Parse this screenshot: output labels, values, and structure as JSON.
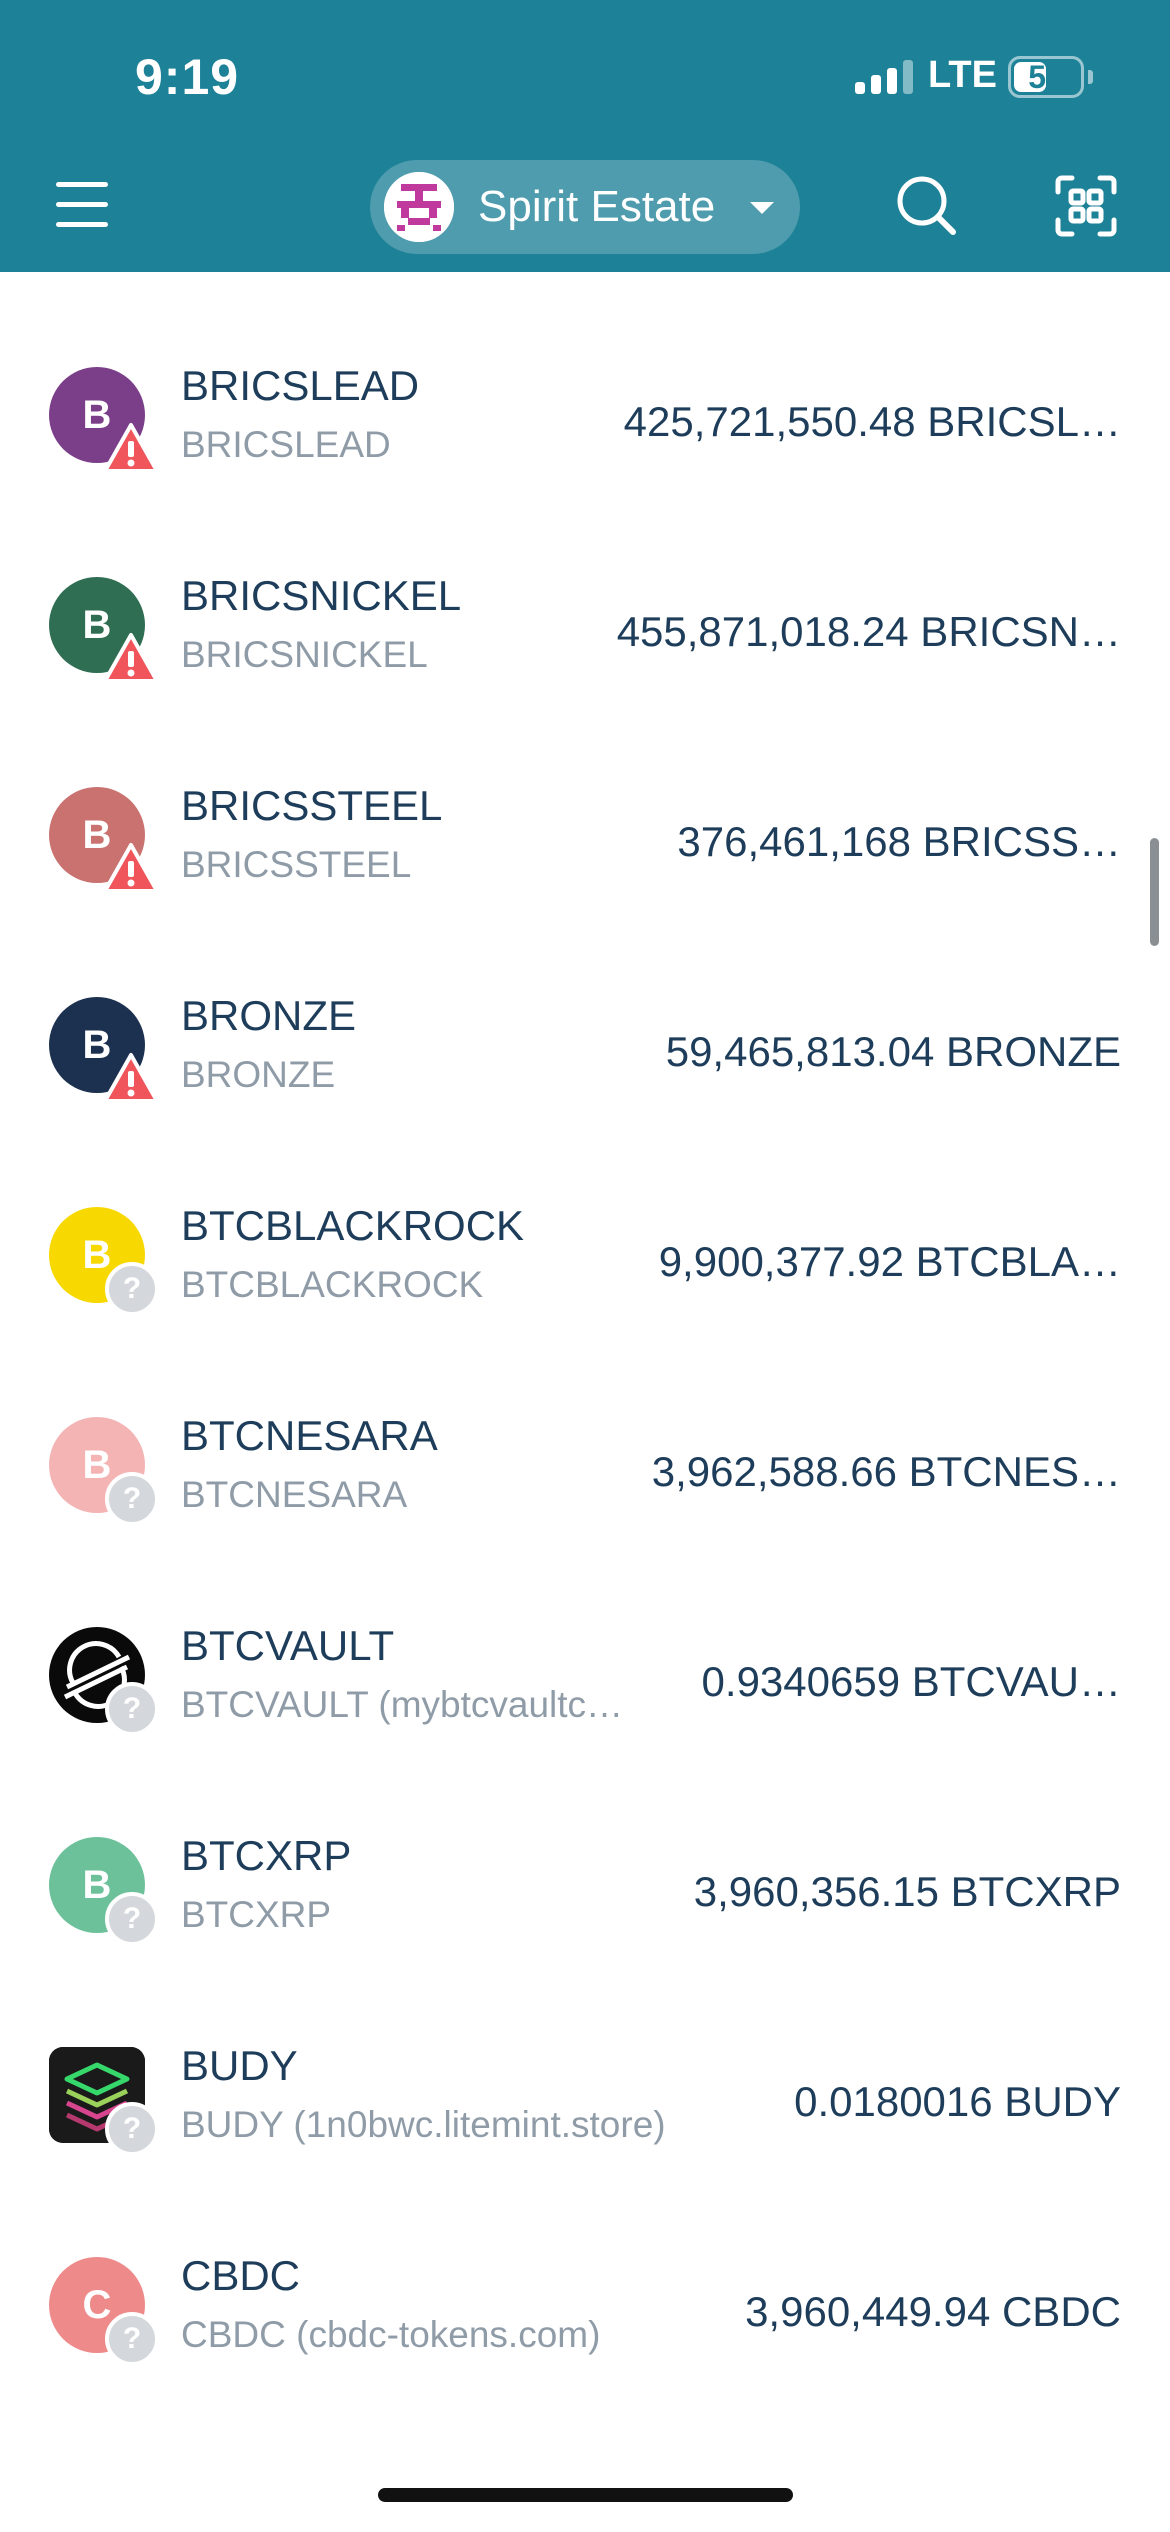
{
  "status_bar": {
    "time": "9:19",
    "network": "LTE",
    "battery": "54",
    "battery_level_percent": 54
  },
  "header": {
    "account_name": "Spirit Estate",
    "icons": {
      "menu": "menu-icon",
      "search": "search-icon",
      "scan": "qr-scan-icon"
    },
    "colors": {
      "background": "#1d8197"
    }
  },
  "assets": [
    {
      "initial": "B",
      "name": "BRICSLEAD",
      "code": "BRICSLEAD",
      "amount": "425,721,550.48 BRICSL…",
      "avatar_color": "#7b3f8a",
      "badge": "warning"
    },
    {
      "initial": "B",
      "name": "BRICSNICKEL",
      "code": "BRICSNICKEL",
      "amount": "455,871,018.24 BRICSN…",
      "avatar_color": "#2f6e52",
      "badge": "warning"
    },
    {
      "initial": "B",
      "name": "BRICSSTEEL",
      "code": "BRICSSTEEL",
      "amount": "376,461,168 BRICSS…",
      "avatar_color": "#c97270",
      "badge": "warning"
    },
    {
      "initial": "B",
      "name": "BRONZE",
      "code": "BRONZE",
      "amount": "59,465,813.04 BRONZE",
      "avatar_color": "#1c3050",
      "badge": "warning"
    },
    {
      "initial": "B",
      "name": "BTCBLACKROCK",
      "code": "BTCBLACKROCK",
      "amount": "9,900,377.92 BTCBLA…",
      "avatar_color": "#f7d800",
      "badge": "unknown"
    },
    {
      "initial": "B",
      "name": "BTCNESARA",
      "code": "BTCNESARA",
      "amount": "3,962,588.66 BTCNES…",
      "avatar_color": "#f4b4b4",
      "badge": "unknown"
    },
    {
      "initial": "",
      "name": "BTCVAULT",
      "code": "BTCVAULT (mybtcvaultc…",
      "amount": "0.9340659 BTCVAU…",
      "avatar_color": "#0a0a0a",
      "badge": "unknown",
      "logo": "stellar-logo-icon"
    },
    {
      "initial": "B",
      "name": "BTCXRP",
      "code": "BTCXRP",
      "amount": "3,960,356.15 BTCXRP",
      "avatar_color": "#6cc19a",
      "badge": "unknown"
    },
    {
      "initial": "",
      "name": "BUDY",
      "code": "BUDY (1n0bwc.litemint.store)",
      "amount": "0.0180016 BUDY",
      "avatar_color": "#1a1a1a",
      "badge": "unknown",
      "logo": "budy-layers-logo-icon"
    },
    {
      "initial": "C",
      "name": "CBDC",
      "code": "CBDC (cbdc-tokens.com)",
      "amount": "3,960,449.94 CBDC",
      "avatar_color": "#ee8a8a",
      "badge": "unknown"
    }
  ]
}
